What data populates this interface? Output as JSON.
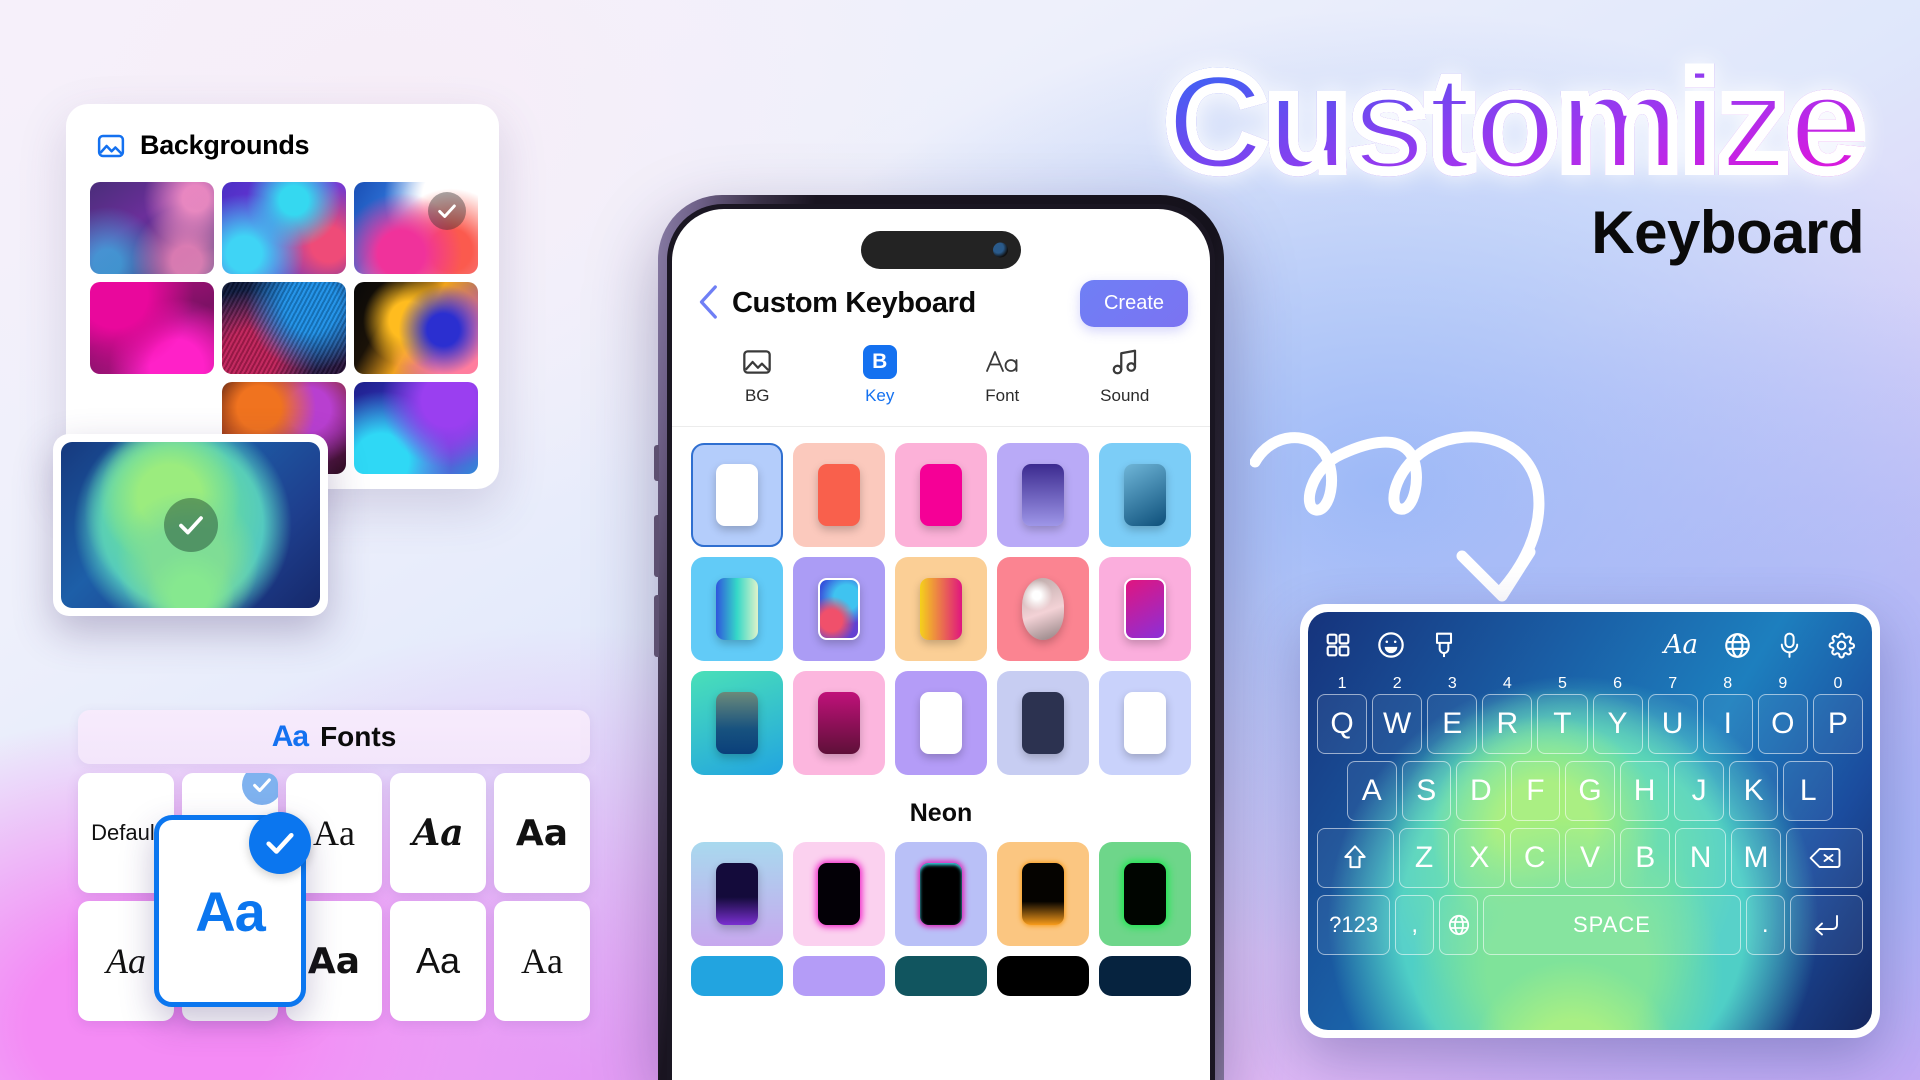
{
  "headline": {
    "title": "Customize",
    "subtitle": "Keyboard"
  },
  "backgrounds_panel": {
    "title": "Backgrounds",
    "icon": "image-icon",
    "thumbs": [
      {
        "id": "bg-1",
        "selected": false
      },
      {
        "id": "bg-2",
        "selected": false
      },
      {
        "id": "bg-3",
        "selected": true
      },
      {
        "id": "bg-4",
        "selected": false
      },
      {
        "id": "bg-5",
        "selected": false
      },
      {
        "id": "bg-6",
        "selected": false
      },
      {
        "id": "bg-7",
        "selected": false
      },
      {
        "id": "bg-8",
        "selected": false
      }
    ],
    "floating_selected": {
      "id": "bg-green-orbs",
      "selected": true,
      "check": "check-icon"
    }
  },
  "fonts_panel": {
    "title": "Fonts",
    "icon_label": "Aa",
    "cells": [
      {
        "label": "Default",
        "style": "plain-small"
      },
      {
        "label": "Aa",
        "style": "sans",
        "checked": true
      },
      {
        "label": "Aa",
        "style": "serif"
      },
      {
        "label": "Aa",
        "style": "script"
      },
      {
        "label": "Aa",
        "style": "sans-bold"
      },
      {
        "label": "Aa",
        "style": "script-italic"
      },
      {
        "label": "Aa",
        "style": "sans"
      },
      {
        "label": "Aa",
        "style": "slab-bold"
      },
      {
        "label": "Aa",
        "style": "sans"
      },
      {
        "label": "Aa",
        "style": "serif"
      }
    ],
    "floating_selected": {
      "label": "Aa",
      "checked": true
    }
  },
  "phone": {
    "nav": {
      "back_icon": "chevron-left-icon",
      "title": "Custom Keyboard",
      "create_label": "Create"
    },
    "tabs": [
      {
        "id": "bg",
        "label": "BG",
        "icon": "image-icon",
        "active": false
      },
      {
        "id": "key",
        "label": "Key",
        "icon": "keyboard-b-icon",
        "active": true
      },
      {
        "id": "font",
        "label": "Font",
        "icon": "font-aa-icon",
        "active": false
      },
      {
        "id": "sound",
        "label": "Sound",
        "icon": "music-note-icon",
        "active": false
      }
    ],
    "swatch_rows": [
      [
        {
          "id": "s1",
          "card": "#b4cdfb",
          "chip": "#ffffff",
          "selected": true
        },
        {
          "id": "s2",
          "card": "#fbc9bd",
          "chip": "#f9604c",
          "selected": false
        },
        {
          "id": "s3",
          "card": "#fcb1d8",
          "chip": "#f50096",
          "selected": false
        },
        {
          "id": "s4",
          "card": "#b9aaf7",
          "chip": "#3b2a8f",
          "selected": false
        },
        {
          "id": "s5",
          "card": "#7ccdf7",
          "chip": "#1b6f9e",
          "selected": false
        }
      ],
      [
        {
          "id": "s6",
          "card": "#62cbf7",
          "chip": "#2f55dd",
          "selected": false
        },
        {
          "id": "s7",
          "card": "#ab9cf5",
          "chip": "#3fc3f0",
          "selected": false
        },
        {
          "id": "s8",
          "card": "#fbcf96",
          "chip": "#f5d11b",
          "selected": false
        },
        {
          "id": "s9",
          "card": "#fb8491",
          "chip": "#e8c7c9",
          "selected": false
        },
        {
          "id": "s10",
          "card": "#fbaedd",
          "chip": "#e0157f",
          "selected": false
        }
      ],
      [
        {
          "id": "s11",
          "card": "#4ad4e0",
          "chip": "#17527f",
          "selected": false
        },
        {
          "id": "s12",
          "card": "#fcb6de",
          "chip": "#a6116a",
          "selected": false
        },
        {
          "id": "s13",
          "card": "#b49cf7",
          "chip": "#ffffff",
          "selected": false
        },
        {
          "id": "s14",
          "card": "#c7cdf2",
          "chip": "#2c3250",
          "selected": false
        },
        {
          "id": "s15",
          "card": "#c9d2fb",
          "chip": "#ffffff",
          "selected": false
        }
      ]
    ],
    "neon_section": {
      "title": "Neon",
      "swatches": [
        {
          "id": "n1",
          "card": "#a8d9ee",
          "chip": "#140b3b",
          "glow": "#7a2fd0"
        },
        {
          "id": "n2",
          "card": "#fbd1ef",
          "chip": "#030006",
          "glow": "#f020c8"
        },
        {
          "id": "n3",
          "card": "#b9c0f7",
          "chip": "#000000",
          "glow": "#e01bb6"
        },
        {
          "id": "n4",
          "card": "#fbc681",
          "chip": "#050300",
          "glow": "#f79b1a"
        },
        {
          "id": "n5",
          "card": "#6ed68a",
          "chip": "#000500",
          "glow": "#16e84a"
        }
      ],
      "peek_row": [
        {
          "id": "p1",
          "card": "#22a4e0"
        },
        {
          "id": "p2",
          "card": "#b49cf7"
        },
        {
          "id": "p3",
          "card": "#11555f"
        },
        {
          "id": "p4",
          "card": "#000000"
        },
        {
          "id": "p5",
          "card": "#06233f"
        }
      ]
    }
  },
  "keyboard_preview": {
    "toolbar_left": [
      "grid-icon",
      "emoji-smile-icon",
      "theme-brush-icon"
    ],
    "toolbar_right": [
      "font-aa-icon",
      "globe-icon",
      "microphone-icon",
      "gear-icon"
    ],
    "row1": [
      {
        "key": "Q",
        "num": "1"
      },
      {
        "key": "W",
        "num": "2"
      },
      {
        "key": "E",
        "num": "3"
      },
      {
        "key": "R",
        "num": "4"
      },
      {
        "key": "T",
        "num": "5"
      },
      {
        "key": "Y",
        "num": "6"
      },
      {
        "key": "U",
        "num": "7"
      },
      {
        "key": "I",
        "num": "8"
      },
      {
        "key": "O",
        "num": "9"
      },
      {
        "key": "P",
        "num": "0"
      }
    ],
    "row2": [
      "A",
      "S",
      "D",
      "F",
      "G",
      "H",
      "J",
      "K",
      "L"
    ],
    "row3": [
      {
        "key": "shift-icon",
        "type": "icon"
      },
      {
        "key": "Z"
      },
      {
        "key": "X"
      },
      {
        "key": "C"
      },
      {
        "key": "V"
      },
      {
        "key": "B"
      },
      {
        "key": "N"
      },
      {
        "key": "M"
      },
      {
        "key": "backspace-icon",
        "type": "icon"
      }
    ],
    "row4": [
      {
        "key": "?123",
        "type": "text"
      },
      {
        "key": ",",
        "type": "text"
      },
      {
        "key": "globe-icon",
        "type": "icon"
      },
      {
        "key": "SPACE",
        "type": "text"
      },
      {
        "key": ".",
        "type": "text"
      },
      {
        "key": "enter-icon",
        "type": "icon"
      }
    ]
  },
  "arrow": {
    "icon": "curly-arrow-icon",
    "color": "#ffffff"
  },
  "colors": {
    "accent_blue": "#1471f0",
    "create_button": "#6f7ff5",
    "headline_gradient_start": "#2f6bf5",
    "headline_gradient_end": "#e419d8"
  }
}
